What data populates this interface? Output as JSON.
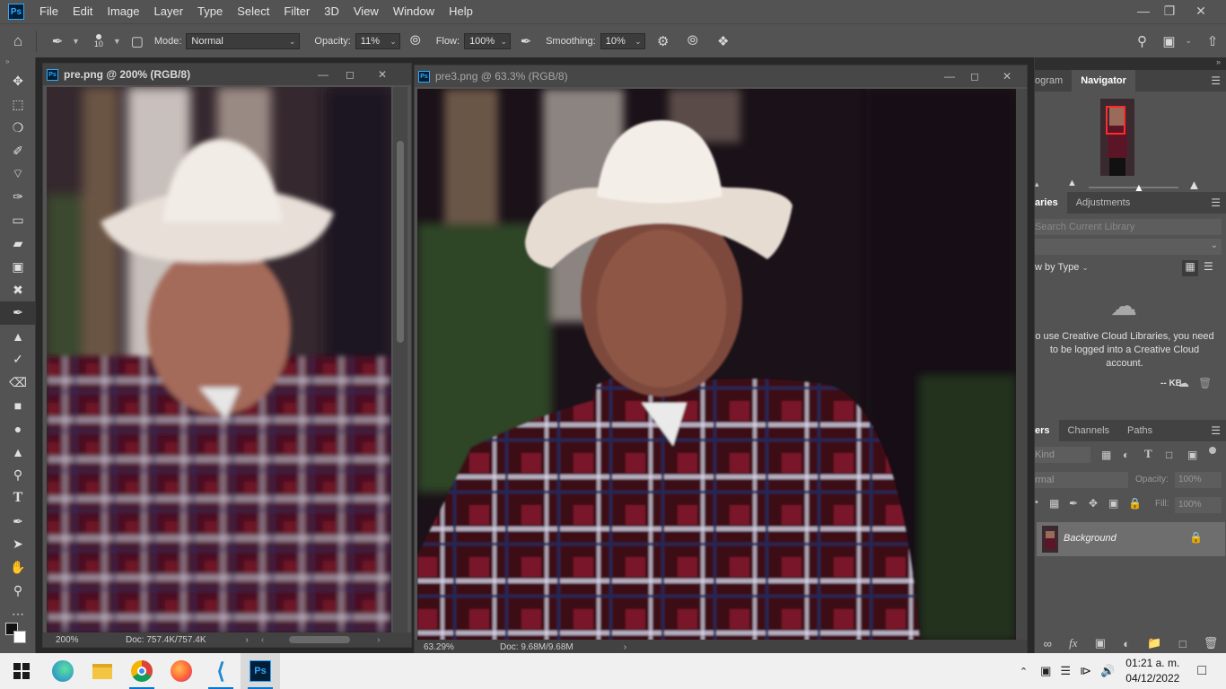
{
  "app": {
    "logo": "Ps"
  },
  "menu": [
    "File",
    "Edit",
    "Image",
    "Layer",
    "Type",
    "Select",
    "Filter",
    "3D",
    "View",
    "Window",
    "Help"
  ],
  "options": {
    "brush_size": "10",
    "mode_label": "Mode:",
    "mode_value": "Normal",
    "opacity_label": "Opacity:",
    "opacity_value": "11%",
    "flow_label": "Flow:",
    "flow_value": "100%",
    "smoothing_label": "Smoothing:",
    "smoothing_value": "10%"
  },
  "documents": [
    {
      "title": "pre.png @ 200% (RGB/8)",
      "zoom": "200%",
      "doc": "Doc: 757.4K/757.4K"
    },
    {
      "title": "pre3.png @ 63.3% (RGB/8)",
      "zoom": "63.29%",
      "doc": "Doc: 9.68M/9.68M"
    }
  ],
  "panels": {
    "top_tabs": [
      "ogram",
      "Navigator"
    ],
    "lib_tabs": [
      "aries",
      "Adjustments"
    ],
    "lib_search_placeholder": "Search Current Library",
    "view_by": "w by Type",
    "cc_message": "o use Creative Cloud Libraries, you need to be logged into a Creative Cloud account.",
    "kb": "-- KB",
    "layer_tabs": [
      "ers",
      "Channels",
      "Paths"
    ],
    "kind_label": "Kind",
    "blend_mode": "rmal",
    "opacity_label": "Opacity:",
    "opacity_value": "100%",
    "fill_label": "Fill:",
    "fill_value": "100%",
    "layer_name": "Background"
  },
  "taskbar": {
    "time": "01:21 a. m.",
    "date": "04/12/2022"
  },
  "colors": {
    "accent": "#31a8ff",
    "nav_box": "#ff2a2a"
  }
}
